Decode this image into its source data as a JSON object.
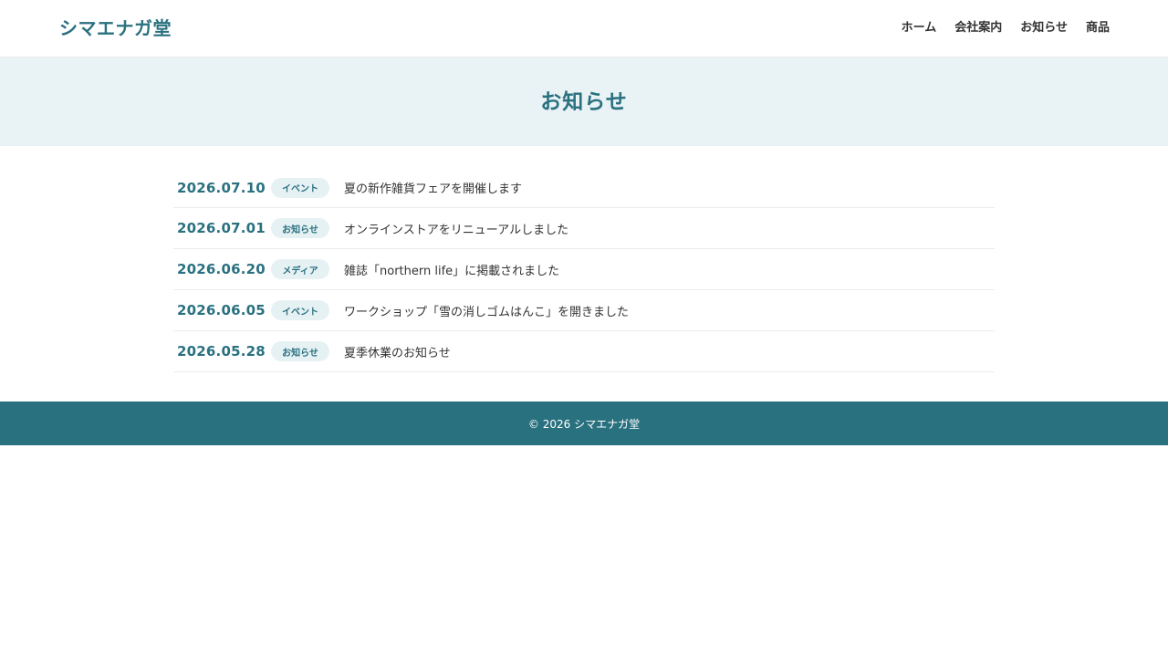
{
  "colors": {
    "accent": "#2a7180",
    "hero_bg": "#e9f2f5",
    "badge_bg": "#e6f1f4",
    "text": "#333333",
    "divider": "#ececec"
  },
  "header": {
    "logo": "シマエナガ堂",
    "nav": [
      {
        "label": "ホーム"
      },
      {
        "label": "会社案内"
      },
      {
        "label": "お知らせ"
      },
      {
        "label": "商品"
      }
    ]
  },
  "hero": {
    "title": "お知らせ"
  },
  "news": [
    {
      "date": "2026.07.10",
      "category": "イベント",
      "title": "夏の新作雑貨フェアを開催します"
    },
    {
      "date": "2026.07.01",
      "category": "お知らせ",
      "title": "オンラインストアをリニューアルしました"
    },
    {
      "date": "2026.06.20",
      "category": "メディア",
      "title": "雑誌「northern life」に掲載されました"
    },
    {
      "date": "2026.06.05",
      "category": "イベント",
      "title": "ワークショップ「雪の消しゴムはんこ」を開きました"
    },
    {
      "date": "2026.05.28",
      "category": "お知らせ",
      "title": "夏季休業のお知らせ"
    }
  ],
  "footer": {
    "copyright": "© 2026 シマエナガ堂"
  }
}
